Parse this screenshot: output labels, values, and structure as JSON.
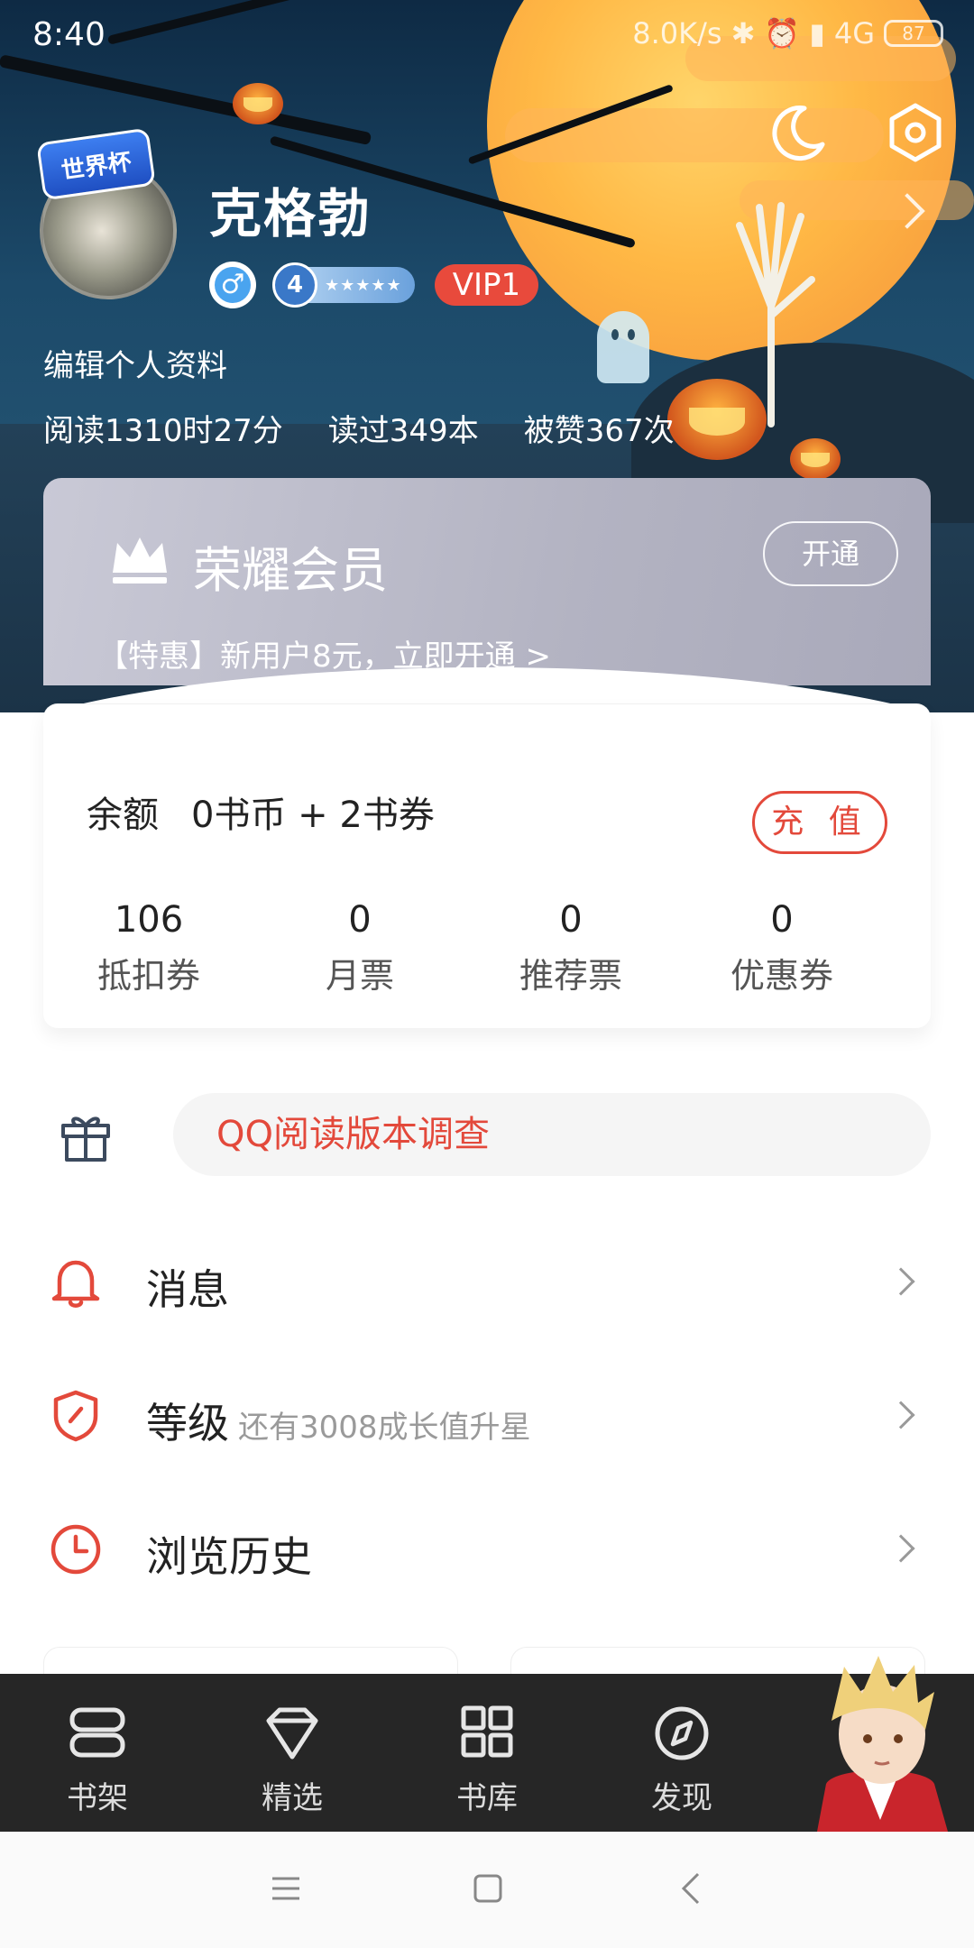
{
  "status_bar": {
    "time": "8:40",
    "network_speed": "8.0K/s",
    "network_type": "4G",
    "battery": "87"
  },
  "profile": {
    "name": "克格勃",
    "badge_text": "世界杯",
    "level": "4",
    "level_stars": "★★★★★",
    "vip": "VIP1",
    "edit_label": "编辑个人资料",
    "stats": {
      "read_time": "阅读1310时27分",
      "books_read": "读过349本",
      "likes": "被赞367次"
    }
  },
  "vip_card": {
    "title": "荣耀会员",
    "open_button": "开通",
    "promo": "【特惠】新用户8元，立即开通 >"
  },
  "balance": {
    "label": "余额",
    "value": "0书币 + 2书券",
    "recharge_button": "充 值",
    "tickets": [
      {
        "num": "106",
        "label": "抵扣券"
      },
      {
        "num": "0",
        "label": "月票"
      },
      {
        "num": "0",
        "label": "推荐票"
      },
      {
        "num": "0",
        "label": "优惠券"
      }
    ]
  },
  "survey": {
    "label": "QQ阅读版本调查"
  },
  "menu": {
    "messages": {
      "label": "消息"
    },
    "level": {
      "label": "等级",
      "sub": "还有3008成长值升星"
    },
    "history": {
      "label": "浏览历史"
    }
  },
  "tabbar": [
    {
      "label": "书架",
      "icon": "bookshelf-icon"
    },
    {
      "label": "精选",
      "icon": "diamond-icon"
    },
    {
      "label": "书库",
      "icon": "grid-icon"
    },
    {
      "label": "发现",
      "icon": "compass-icon"
    }
  ],
  "colors": {
    "accent": "#e3493b",
    "tabbar_bg": "#262626",
    "hero_bg": "#1c4a6a",
    "moon": "#ffb845"
  }
}
